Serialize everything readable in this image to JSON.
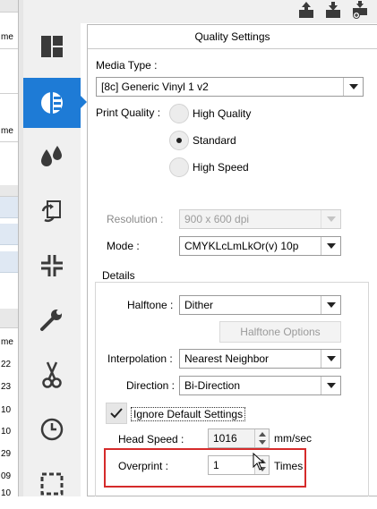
{
  "left_panel": {
    "cells": [
      "me",
      "me",
      "me",
      "22",
      "23",
      "10",
      "10",
      "29",
      "09",
      "10"
    ]
  },
  "sidebar": {
    "items": [
      {
        "name": "layout-icon"
      },
      {
        "name": "quality-settings-icon",
        "active": true
      },
      {
        "name": "color-drops-icon"
      },
      {
        "name": "job-recycle-icon"
      },
      {
        "name": "crop-marks-icon"
      },
      {
        "name": "wrench-icon"
      },
      {
        "name": "scissors-icon"
      },
      {
        "name": "clock-icon"
      },
      {
        "name": "selection-icon"
      }
    ]
  },
  "toolbar": {
    "icons": [
      "export-up-icon",
      "import-down-icon",
      "add-job-icon"
    ]
  },
  "panel": {
    "title": "Quality Settings",
    "media_type_label": "Media Type :",
    "media_type_value": "[8c] Generic Vinyl 1 v2",
    "print_quality_label": "Print Quality :",
    "print_quality_options": [
      "High Quality",
      "Standard",
      "High Speed"
    ],
    "print_quality_selected": "Standard",
    "resolution_label": "Resolution :",
    "resolution_value": "900 x 600 dpi",
    "mode_label": "Mode :",
    "mode_value": "CMYKLcLmLkOr(v) 10p"
  },
  "details": {
    "title": "Details",
    "halftone_label": "Halftone :",
    "halftone_value": "Dither",
    "halftone_options_button": "Halftone Options",
    "interpolation_label": "Interpolation :",
    "interpolation_value": "Nearest Neighbor",
    "direction_label": "Direction :",
    "direction_value": "Bi-Direction",
    "ignore_default_label": "Ignore Default Settings",
    "ignore_default_checked": true,
    "head_speed_label": "Head Speed :",
    "head_speed_value": "1016",
    "head_speed_unit": "mm/sec",
    "overprint_label": "Overprint :",
    "overprint_value": "1",
    "overprint_unit": "Times"
  },
  "colors": {
    "accent": "#1e7bd6",
    "highlight": "#d52b2b"
  }
}
